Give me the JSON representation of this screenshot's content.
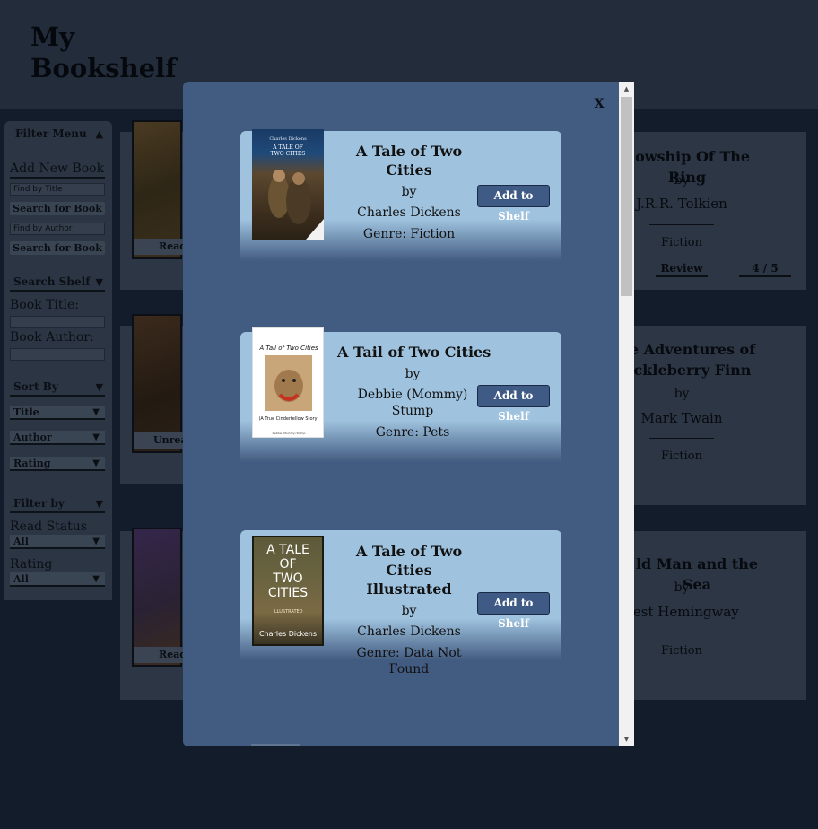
{
  "header": {
    "title": "My Bookshelf"
  },
  "sidebar": {
    "filter_menu": "Filter Menu",
    "filter_menu_arrow": "▲",
    "add_new_book": "Add New Book",
    "find_by_title_placeholder": "Find by Title",
    "search_button": "Search for Book",
    "find_by_author_placeholder": "Find by Author",
    "search_shelf": "Search Shelf",
    "book_title_label": "Book Title:",
    "book_author_label": "Book Author:",
    "sort_by": "Sort By",
    "sort_options": [
      "Title",
      "Author",
      "Rating"
    ],
    "filter_by": "Filter by",
    "read_status_label": "Read Status",
    "read_status_value": "All",
    "rating_label": "Rating",
    "rating_value": "All",
    "arrow_down": "▼"
  },
  "shelf": {
    "left_buttons": [
      "Read",
      "Unread",
      "Read"
    ],
    "right_cards": [
      {
        "title": "llowship Of The Ring",
        "by": "by",
        "author": "J.R.R. Tolkien",
        "genre": "Fiction",
        "review": "Review",
        "rating": "4 / 5"
      },
      {
        "title": "e Adventures of ckleberry Finn",
        "by": "by",
        "author": "Mark Twain",
        "genre": "Fiction"
      },
      {
        "title": "ld Man and the Sea",
        "by": "by",
        "author": "nest Hemingway",
        "genre": "Fiction"
      }
    ]
  },
  "modal": {
    "close_label": "X",
    "add_label": "Add to Shelf",
    "results": [
      {
        "title": "A Tale of Two Cities",
        "by": "by",
        "author": "Charles Dickens",
        "genre": "Genre: Fiction",
        "cover_lines": [
          "Charles Dickens",
          "A TALE OF",
          "TWO CITIES"
        ]
      },
      {
        "title": "A Tail of Two Cities",
        "by": "by",
        "author": "Debbie (Mommy) Stump",
        "genre": "Genre: Pets",
        "cover_lines": [
          "A Tail of Two Cities",
          "(A True Cinderfellow Story)",
          "Debbie (Mommy) Stump"
        ]
      },
      {
        "title": "A Tale of Two Cities Illustrated",
        "by": "by",
        "author": "Charles Dickens",
        "genre": "Genre: Data Not Found",
        "cover_lines": [
          "A TALE",
          "OF",
          "TWO",
          "CITIES",
          "ILLUSTRATED",
          "Charles Dickens"
        ]
      }
    ]
  },
  "colors": {
    "modal_bg": "#425b80",
    "card_bg": "#9fc3df",
    "button_bg": "#3f5a85",
    "page_bg": "#131c2a"
  }
}
